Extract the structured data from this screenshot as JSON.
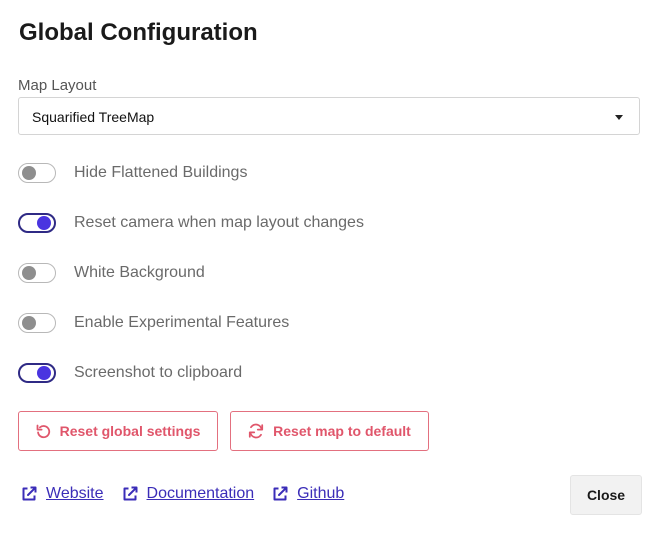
{
  "dialog": {
    "title": "Global Configuration"
  },
  "map_layout": {
    "label": "Map Layout",
    "selected": "Squarified TreeMap"
  },
  "toggles": [
    {
      "label": "Hide Flattened Buildings",
      "checked": false
    },
    {
      "label": "Reset camera when map layout changes",
      "checked": true
    },
    {
      "label": "White Background",
      "checked": false
    },
    {
      "label": "Enable Experimental Features",
      "checked": false
    },
    {
      "label": "Screenshot to clipboard",
      "checked": true
    }
  ],
  "actions": {
    "reset_global": "Reset global settings",
    "reset_map": "Reset map to default"
  },
  "links": [
    {
      "label": "Website",
      "icon": "external-link-icon"
    },
    {
      "label": "Documentation",
      "icon": "external-link-icon"
    },
    {
      "label": "Github",
      "icon": "external-link-icon"
    }
  ],
  "footer": {
    "close_label": "Close"
  },
  "colors": {
    "accent": "#4a35e0",
    "danger": "#e0566b",
    "link": "#3b2db8"
  }
}
